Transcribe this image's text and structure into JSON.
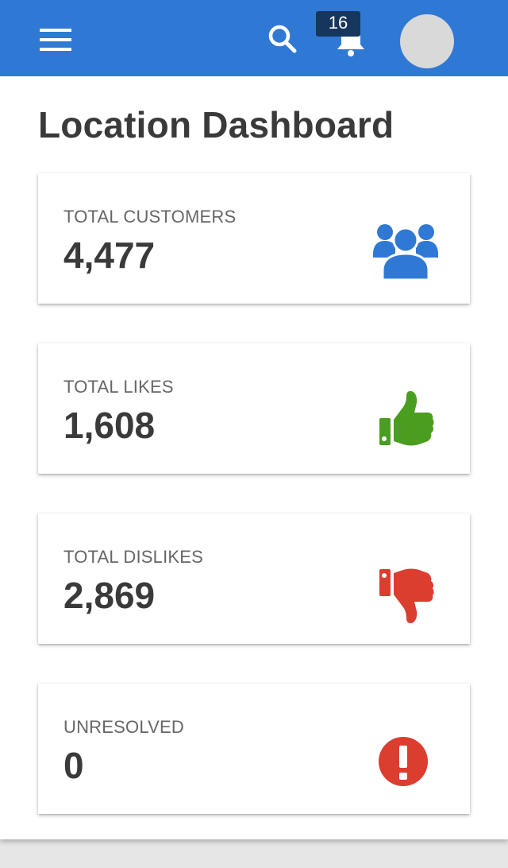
{
  "header": {
    "notification_count": "16",
    "colors": {
      "bar": "#2f79d5",
      "badge": "#17365d"
    }
  },
  "page": {
    "title": "Location Dashboard"
  },
  "cards": [
    {
      "label": "TOTAL CUSTOMERS",
      "value": "4,477",
      "icon": "users-icon",
      "color": "#2f79d5"
    },
    {
      "label": "TOTAL LIKES",
      "value": "1,608",
      "icon": "thumbs-up-icon",
      "color": "#4a9e1f"
    },
    {
      "label": "TOTAL DISLIKES",
      "value": "2,869",
      "icon": "thumbs-down-icon",
      "color": "#db3d2f"
    },
    {
      "label": "UNRESOLVED",
      "value": "0",
      "icon": "exclamation-circle-icon",
      "color": "#db3d2f"
    }
  ]
}
